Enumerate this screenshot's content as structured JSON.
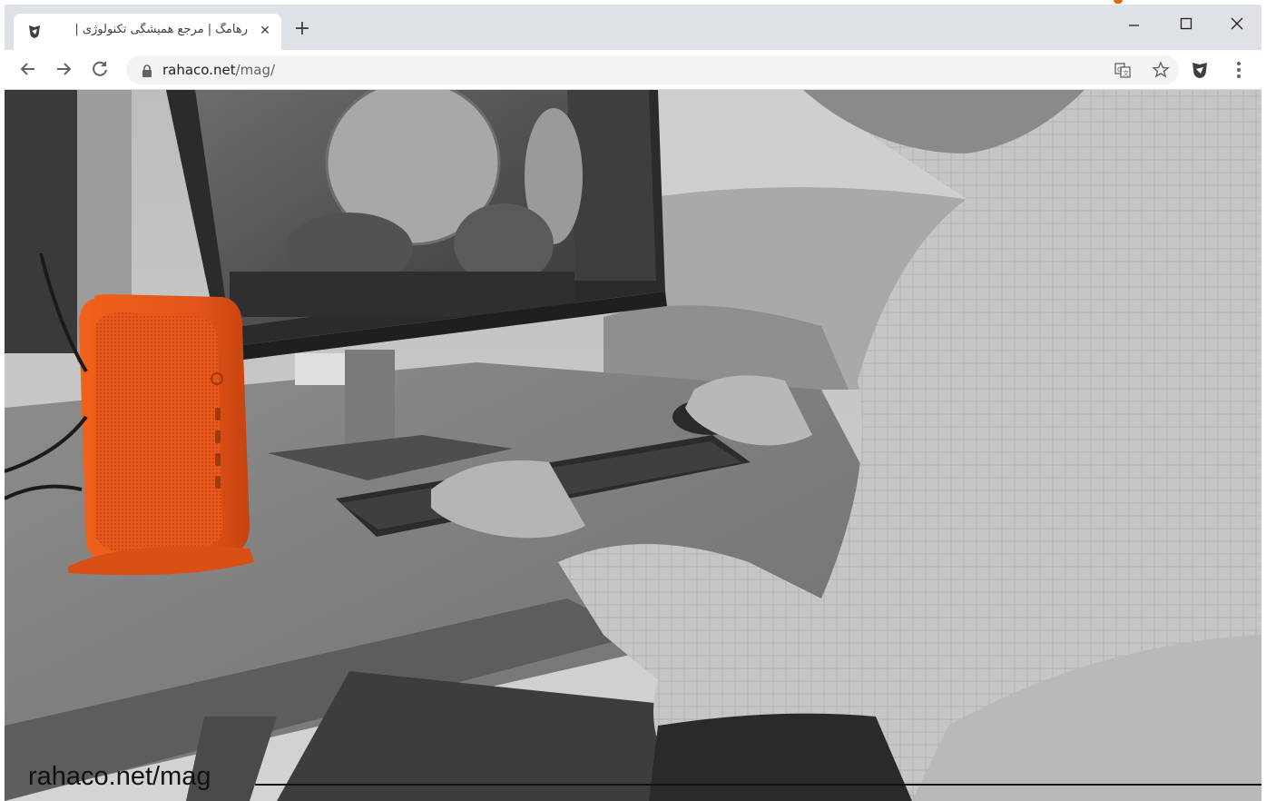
{
  "browser": {
    "tab": {
      "title": "رهامگ | مرجع همیشگی تکنولوژی |",
      "favicon": "rahaco-logo-icon",
      "close_icon": "close-icon"
    },
    "new_tab_icon": "plus-icon",
    "window_controls": [
      "minimize-icon",
      "maximize-icon",
      "close-icon"
    ],
    "toolbar": {
      "back_icon": "arrow-left-icon",
      "forward_icon": "arrow-right-icon",
      "reload_icon": "reload-icon",
      "url_host": "rahaco.net",
      "url_path": "/mag/",
      "translate_icon": "translate-icon",
      "bookmark_icon": "star-icon",
      "extension_icon": "rahaco-extension-icon",
      "menu_icon": "kebab-menu-icon"
    }
  },
  "page": {
    "hero_image": "office-desk-photo",
    "watermark": "rahaco.net/mag"
  },
  "colors": {
    "accent_orange": "#e8650a",
    "tabstrip": "#dee1e6",
    "omnibox": "#f1f3f4"
  }
}
